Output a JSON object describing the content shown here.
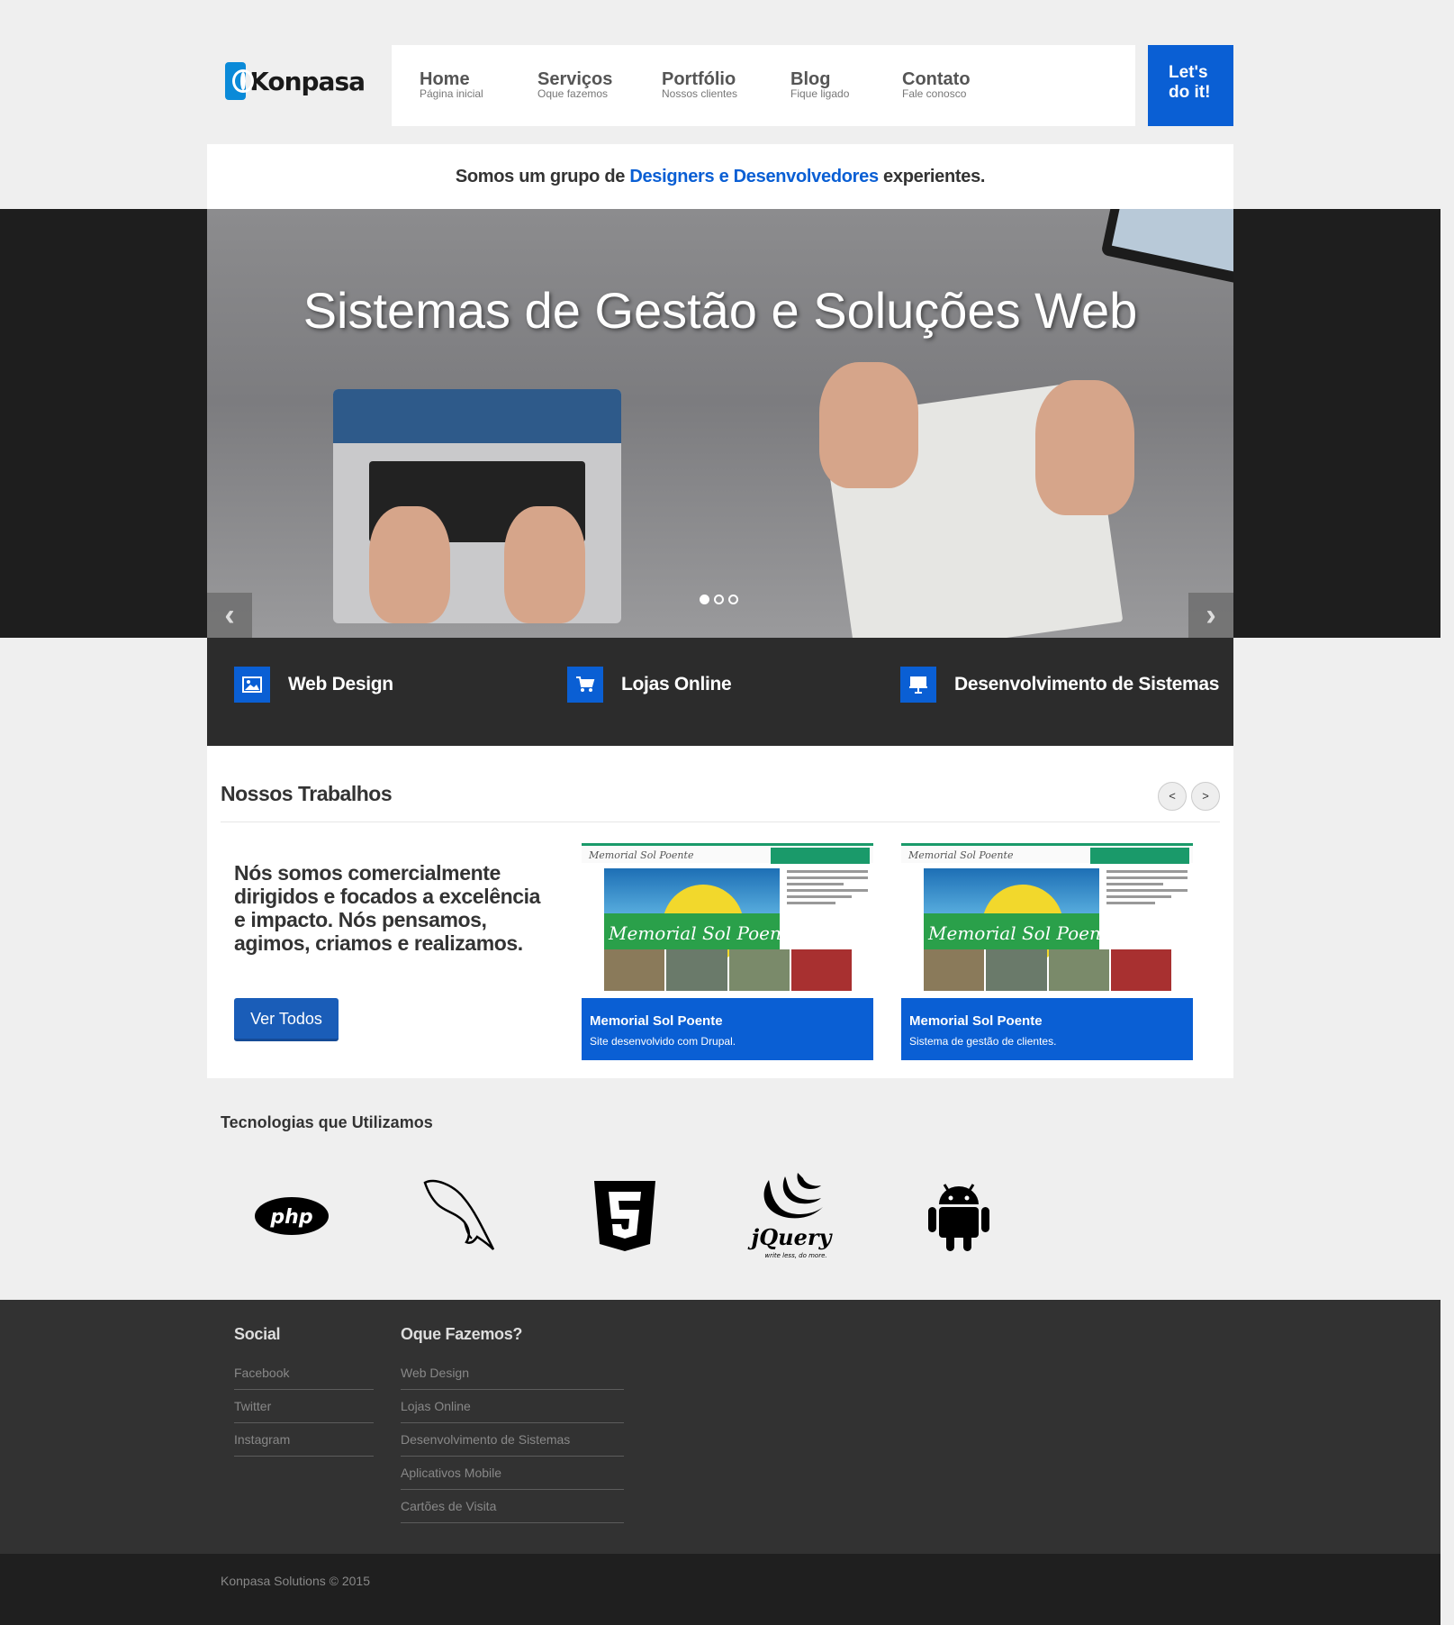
{
  "brand": {
    "name": "Konpasa",
    "accent": "#0a5fd4",
    "logo_color": "#0a8ad8"
  },
  "nav": {
    "items": [
      {
        "label": "Home",
        "sub": "Página inicial"
      },
      {
        "label": "Serviços",
        "sub": "Oque fazemos"
      },
      {
        "label": "Portfólio",
        "sub": "Nossos clientes"
      },
      {
        "label": "Blog",
        "sub": "Fique ligado"
      },
      {
        "label": "Contato",
        "sub": "Fale conosco"
      }
    ],
    "cta_line1": "Let's",
    "cta_line2": "do it!"
  },
  "tagline": {
    "before": "Somos um grupo de ",
    "highlight": "Designers e Desenvolvedores",
    "after": " experientes."
  },
  "hero": {
    "title": "Sistemas de Gestão e Soluções Web",
    "prev_label": "‹",
    "next_label": "›",
    "slide_count": 3,
    "active_slide": 1
  },
  "services": [
    {
      "label": "Web Design",
      "icon": "image-icon"
    },
    {
      "label": "Lojas Online",
      "icon": "cart-icon"
    },
    {
      "label": "Desenvolvimento de Sistemas",
      "icon": "presentation-icon"
    }
  ],
  "works": {
    "title": "Nossos Trabalhos",
    "prev": "<",
    "next": ">",
    "text": "Nós somos comercialmente dirigidos e focados a excelência e impacto. Nós pensamos, agimos, criamos e realizamos.",
    "button": "Ver Todos",
    "cards": [
      {
        "title": "Memorial Sol Poente",
        "desc": "Site desenvolvido com Drupal.",
        "thumb_logo": "Memorial Sol Poente"
      },
      {
        "title": "Memorial Sol Poente",
        "desc": "Sistema de gestão de clientes.",
        "thumb_logo": "Memorial Sol Poente"
      }
    ]
  },
  "tech": {
    "title": "Tecnologias que Utilizamos",
    "items": [
      "php-logo",
      "mysql-dolphin-logo",
      "html5-logo",
      "jquery-logo",
      "android-logo"
    ],
    "php_text": "php",
    "jquery_text": "jQuery",
    "jquery_tagline": "write less, do more."
  },
  "footer": {
    "social_title": "Social",
    "social": [
      "Facebook",
      "Twitter",
      "Instagram"
    ],
    "services_title": "Oque Fazemos?",
    "services": [
      "Web Design",
      "Lojas Online",
      "Desenvolvimento de Sistemas",
      "Aplicativos Mobile",
      "Cartões de Visita"
    ],
    "copyright": "Konpasa Solutions © 2015"
  }
}
